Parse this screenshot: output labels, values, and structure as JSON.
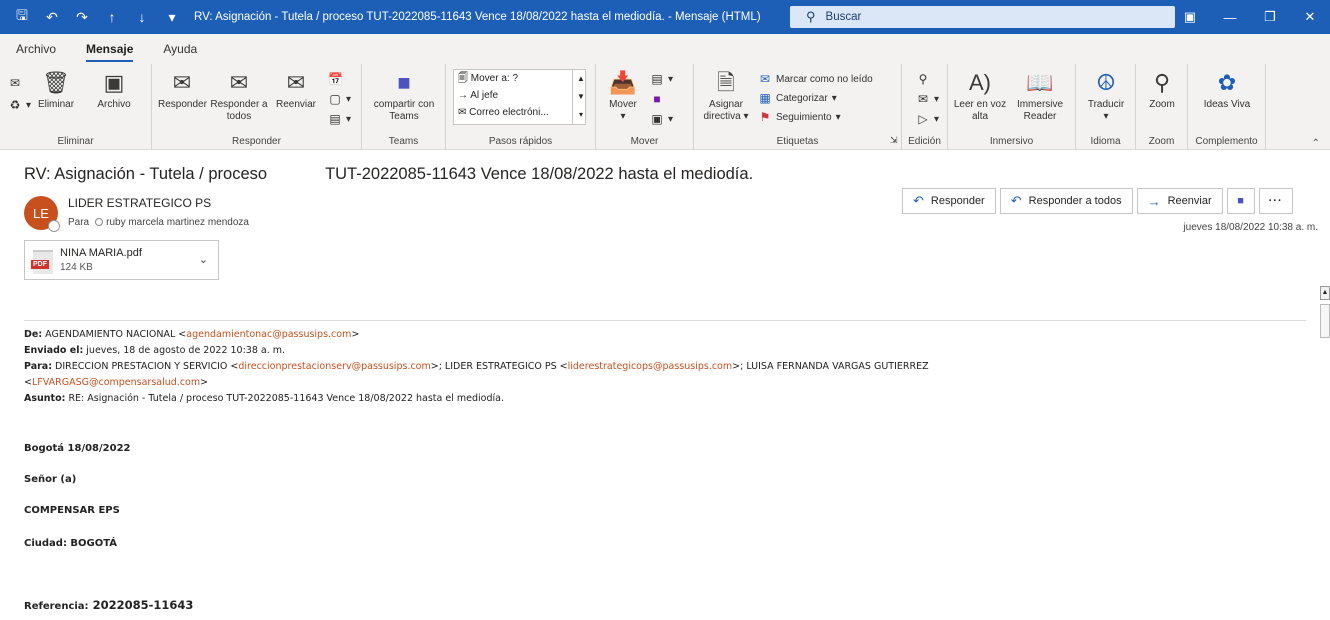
{
  "window": {
    "title": "RV: Asignación - Tutela / proceso  TUT-2022085-11643 Vence 18/08/2022 hasta el mediodía.  -  Mensaje (HTML)",
    "search_placeholder": "Buscar"
  },
  "menu": [
    "Archivo",
    "Mensaje",
    "Ayuda"
  ],
  "ribbon": {
    "eliminar": {
      "label": "Eliminar",
      "delete": "Eliminar",
      "archive": "Archivo"
    },
    "responder": {
      "label": "Responder",
      "reply": "Responder",
      "reply_all": "Responder a todos",
      "forward": "Reenviar"
    },
    "teams": {
      "label": "Teams",
      "share": "compartir con Teams"
    },
    "pasos": {
      "label": "Pasos rápidos",
      "items": [
        "Mover a: ?",
        "Al jefe",
        "Correo electróni..."
      ]
    },
    "mover": {
      "label": "Mover",
      "move": "Mover"
    },
    "etiquetas": {
      "label": "Etiquetas",
      "assign": "Asignar directiva",
      "mark_unread": "Marcar como no leído",
      "categorize": "Categorizar",
      "followup": "Seguimiento"
    },
    "edicion": {
      "label": "Edición"
    },
    "inmersivo": {
      "label": "Inmersivo",
      "read_aloud": "Leer en voz alta",
      "immersive": "Immersive Reader"
    },
    "idioma": {
      "label": "Idioma",
      "translate": "Traducir"
    },
    "zoom": {
      "label": "Zoom",
      "zoom": "Zoom"
    },
    "complemento": {
      "label": "Complemento",
      "ideas": "Ideas Viva"
    }
  },
  "message": {
    "subject_part1": "RV: Asignación - Tutela / proceso",
    "subject_part2": "TUT-2022085-11643 Vence 18/08/2022 hasta el mediodía.",
    "avatar_initials": "LE",
    "sender": "LIDER ESTRATEGICO PS",
    "to_label": "Para",
    "to": "ruby marcela martinez mendoza",
    "date": "jueves 18/08/2022 10:38 a. m.",
    "attachment": {
      "name": "NINA MARIA.pdf",
      "size": "124 KB",
      "badge": "PDF"
    },
    "actions": {
      "reply": "Responder",
      "reply_all": "Responder a todos",
      "forward": "Reenviar"
    }
  },
  "body": {
    "de_label": "De:",
    "de_name": "AGENDAMIENTO NACIONAL <",
    "de_email": "agendamientonac@passusips.com",
    "enviado_label": "Enviado el:",
    "enviado": "jueves, 18 de agosto de 2022 10:38 a. m.",
    "para_label": "Para:",
    "para_1": "DIRECCION PRESTACION Y SERVICIO <",
    "para_1_email": "direccionprestacionserv@passusips.com",
    "para_2": ">; LIDER ESTRATEGICO PS <",
    "para_2_email": "liderestrategicops@passusips.com",
    "para_3": ">; LUISA FERNANDA VARGAS GUTIERREZ",
    "para_4_email": "LFVARGASG@compensarsalud.com",
    "asunto_label": "Asunto:",
    "asunto": "RE: Asignación - Tutela / proceso TUT-2022085-11643 Vence 18/08/2022 hasta el mediodía.",
    "lines": [
      "Bogotá 18/08/2022",
      "Señor (a)",
      "COMPENSAR EPS",
      "Ciudad: BOGOTÁ"
    ],
    "ref_label": "Referencia:",
    "ref_value": "2022085-11643"
  }
}
